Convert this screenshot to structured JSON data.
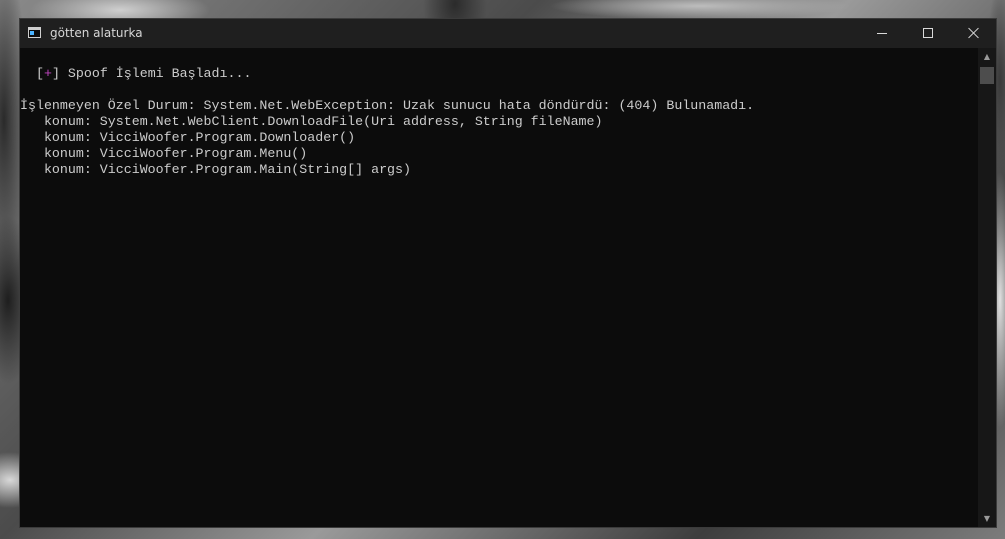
{
  "window": {
    "title": "götten alaturka"
  },
  "console": {
    "line1_prefix": " [",
    "line1_plus": "+",
    "line1_suffix": "] Spoof İşlemi Başladı...",
    "lines": [
      "İşlenmeyen Özel Durum: System.Net.WebException: Uzak sunucu hata döndürdü: (404) Bulunamadı.",
      "   konum: System.Net.WebClient.DownloadFile(Uri address, String fileName)",
      "   konum: VicciWoofer.Program.Downloader()",
      "   konum: VicciWoofer.Program.Menu()",
      "   konum: VicciWoofer.Program.Main(String[] args)"
    ]
  },
  "scrollbar": {
    "up_icon": "▲",
    "down_icon": "▼"
  },
  "colors": {
    "console_bg": "#0c0c0c",
    "text": "#cccccc",
    "accent_plus": "#c044c0",
    "titlebar_bg": "#1f1f1f"
  }
}
